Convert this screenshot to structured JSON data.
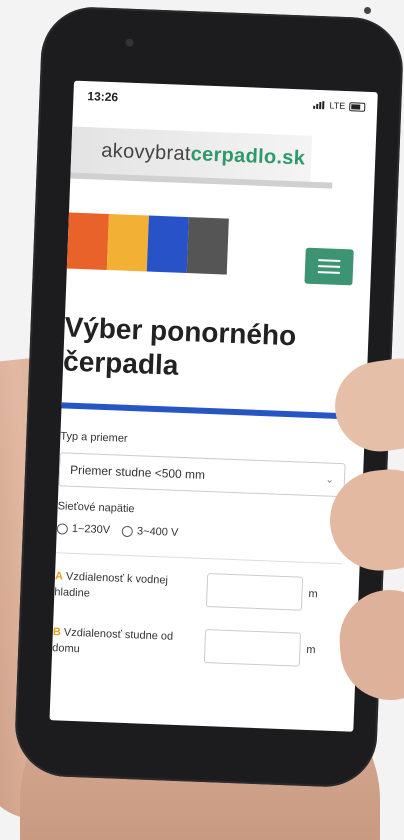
{
  "status_bar": {
    "time": "13:26",
    "network": "LTE"
  },
  "logo": {
    "text_plain": "akovybrat",
    "text_accent": "cerpadlo.sk"
  },
  "brand_colors": [
    "#e8622a",
    "#f2b035",
    "#2853c8",
    "#555555"
  ],
  "accent_color": "#3c9473",
  "title": "Výber ponorného čerpadla",
  "form": {
    "type_label": "Typ a priemer",
    "type_selected": "Priemer studne <500 mm",
    "voltage_label": "Sieťové napätie",
    "voltage_options": [
      "1~230V",
      "3~400 V"
    ],
    "fields": [
      {
        "letter": "A",
        "label": "Vzdialenosť k vodnej hladine",
        "unit": "m"
      },
      {
        "letter": "B",
        "label": "Vzdialenosť studne od domu",
        "unit": "m"
      }
    ]
  }
}
